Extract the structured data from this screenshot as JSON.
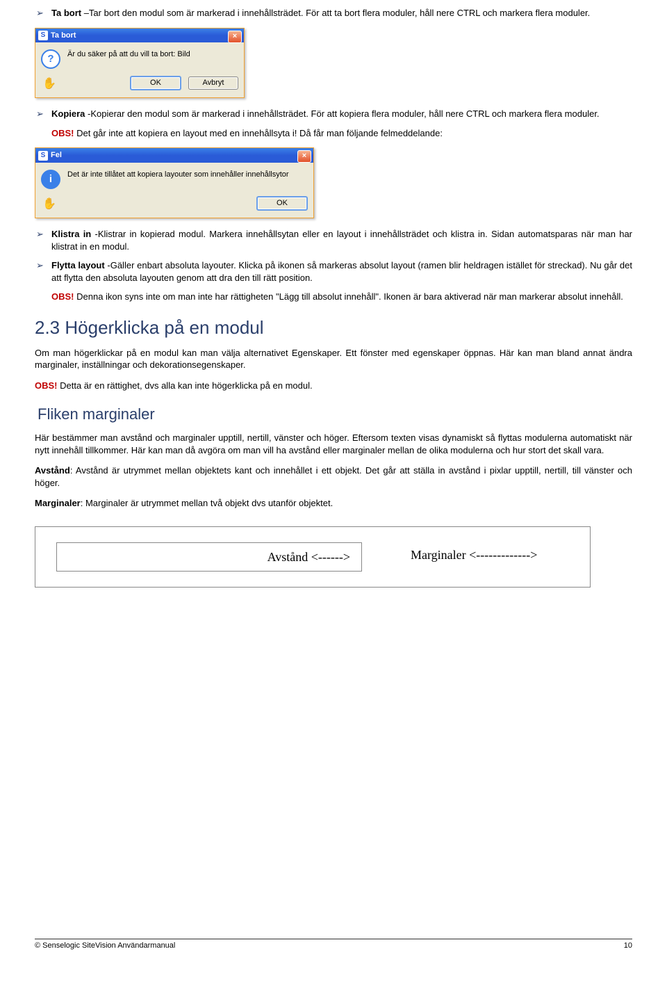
{
  "bullets": {
    "tabort": {
      "title": "Ta bort",
      "text": " –Tar bort den modul som är markerad i innehållsträdet. För att ta bort flera moduler, håll nere CTRL och markera flera moduler."
    },
    "kopiera": {
      "title": "Kopiera",
      "text": " -Kopierar den modul som är markerad i innehållsträdet. För att kopiera flera moduler, håll nere CTRL och markera flera moduler.",
      "obs_label": "OBS!",
      "obs_text": " Det går inte att kopiera en layout med en innehållsyta i! Då får man följande felmeddelande:"
    },
    "klistra": {
      "title": "Klistra in",
      "text": " -Klistrar in kopierad modul. Markera innehållsytan eller en layout i innehållsträdet och klistra in. Sidan automatsparas när man har klistrat in en modul."
    },
    "flytta": {
      "title": "Flytta layout",
      "text": " -Gäller enbart absoluta layouter. Klicka på ikonen så markeras absolut layout (ramen blir heldragen istället för streckad). Nu går det att flytta den absoluta layouten genom att dra den till rätt position.",
      "obs_label": "OBS!",
      "obs_text": " Denna ikon syns inte om man inte har rättigheten \"Lägg till absolut innehåll\". Ikonen är bara aktiverad när man markerar absolut innehåll."
    }
  },
  "dialog1": {
    "title": "Ta bort",
    "message": "Är du säker på att du vill ta bort: Bild",
    "ok": "OK",
    "cancel": "Avbryt"
  },
  "dialog2": {
    "title": "Fel",
    "message": "Det är inte tillåtet att kopiera layouter som innehåller innehållsytor",
    "ok": "OK"
  },
  "section23": {
    "heading": "2.3 Högerklicka på en modul",
    "p1": "Om man högerklickar på en modul kan man välja alternativet Egenskaper. Ett fönster med egenskaper öppnas. Här kan man bland annat ändra marginaler, inställningar och dekorationsegenskaper.",
    "obs_label": "OBS!",
    "obs_text": " Detta är en rättighet, dvs alla kan inte högerklicka på en modul."
  },
  "fliken": {
    "heading": "Fliken marginaler",
    "p1": "Här bestämmer man avstånd och marginaler upptill, nertill, vänster och höger. Eftersom texten visas dynamiskt så flyttas modulerna automatiskt när nytt innehåll tillkommer. Här kan man då avgöra om man vill ha avstånd eller marginaler mellan de olika modulerna och hur stort det skall vara.",
    "avstand_label": "Avstånd",
    "avstand_text": ": Avstånd är utrymmet mellan objektets kant och innehållet i ett objekt. Det går att ställa in avstånd i pixlar upptill, nertill, till vänster och höger.",
    "marg_label": "Marginaler",
    "marg_text": ": Marginaler är utrymmet mellan två objekt dvs utanför objektet."
  },
  "diagram": {
    "avstand": "Avstånd <------>",
    "marginaler": "Marginaler <------------->"
  },
  "footer": {
    "left": "© Senselogic SiteVision Användarmanual",
    "right": "10"
  }
}
